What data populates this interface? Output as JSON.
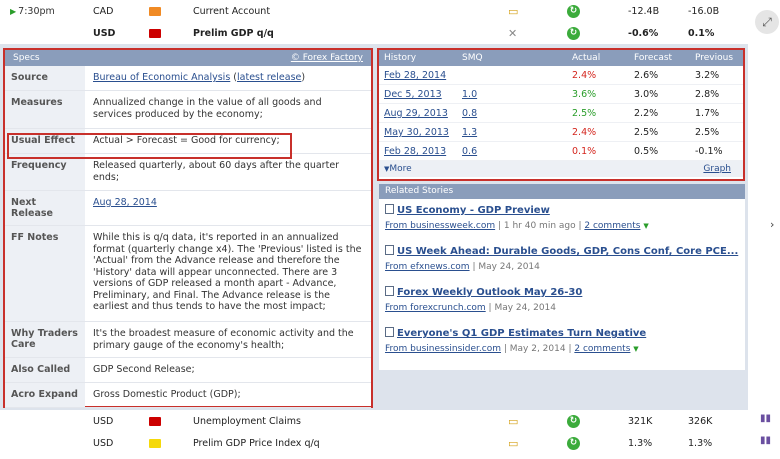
{
  "calendar": {
    "top_row": {
      "time": "7:30pm",
      "currency": "CAD",
      "flag_color": "#f08a24",
      "event": "Current Account",
      "actual": "-12.4B",
      "forecast": "-16.0B"
    },
    "usd_row": {
      "currency": "USD",
      "flag_color": "#cc0000",
      "event": "Prelim GDP q/q",
      "actual": "-0.6%",
      "forecast": "0.1%"
    },
    "bottom_rows": [
      {
        "currency": "USD",
        "flag_color": "#cc0000",
        "event": "Unemployment Claims",
        "actual": "321K",
        "forecast": "326K"
      },
      {
        "currency": "USD",
        "flag_color": "#f5d90a",
        "event": "Prelim GDP Price Index q/q",
        "actual": "1.3%",
        "forecast": "1.3%"
      }
    ]
  },
  "specs": {
    "header": "Specs",
    "source_link": "© Forex Factory",
    "rows": {
      "source": {
        "label": "Source",
        "link": "Bureau of Economic Analysis",
        "paren_open": " (",
        "link2": "latest release",
        "paren_close": ")"
      },
      "measures": {
        "label": "Measures",
        "value": "Annualized change in the value of all goods and services produced by the economy;"
      },
      "usual_effect": {
        "label": "Usual Effect",
        "value": "Actual > Forecast = Good for currency;"
      },
      "frequency": {
        "label": "Frequency",
        "value": "Released quarterly, about 60 days after the quarter ends;"
      },
      "next_release": {
        "label": "Next Release",
        "value": "Aug 28, 2014"
      },
      "ff_notes": {
        "label": "FF Notes",
        "value": "While this is q/q data, it's reported in an annualized format (quarterly change x4). The 'Previous' listed is the 'Actual' from the Advance release and therefore the 'History' data will appear unconnected. There are 3 versions of GDP released a month apart - Advance, Preliminary, and Final. The Advance release is the earliest and thus tends to have the most impact;"
      },
      "why_traders_care": {
        "label": "Why Traders Care",
        "value": "It's the broadest measure of economic activity and the primary gauge of the economy's health;"
      },
      "also_called": {
        "label": "Also Called",
        "value": "GDP Second Release;"
      },
      "acro_expand": {
        "label": "Acro Expand",
        "value": "Gross Domestic Product (GDP);"
      }
    }
  },
  "history": {
    "headers": {
      "history": "History",
      "smq": "SMQ",
      "actual": "Actual",
      "forecast": "Forecast",
      "previous": "Previous"
    },
    "rows": [
      {
        "date": "Feb 28, 2014",
        "smq": "",
        "actual": "2.4%",
        "actual_status": "red",
        "forecast": "2.6%",
        "previous": "3.2%"
      },
      {
        "date": "Dec 5, 2013",
        "smq": "1.0",
        "actual": "3.6%",
        "actual_status": "green",
        "forecast": "3.0%",
        "previous": "2.8%"
      },
      {
        "date": "Aug 29, 2013",
        "smq": "0.8",
        "actual": "2.5%",
        "actual_status": "green",
        "forecast": "2.2%",
        "previous": "1.7%"
      },
      {
        "date": "May 30, 2013",
        "smq": "1.3",
        "actual": "2.4%",
        "actual_status": "red",
        "forecast": "2.5%",
        "previous": "2.5%"
      },
      {
        "date": "Feb 28, 2013",
        "smq": "0.6",
        "actual": "0.1%",
        "actual_status": "red",
        "forecast": "0.5%",
        "previous": "-0.1%"
      }
    ],
    "more": "More",
    "graph": "Graph"
  },
  "related": {
    "header": "Related Stories",
    "stories": [
      {
        "title": "US Economy - GDP Preview",
        "source": "From businessweek.com",
        "sep1": " | ",
        "time": "1 hr 40 min ago",
        "sep2": " | ",
        "comments": "2 comments"
      },
      {
        "title": "US Week Ahead: Durable Goods, GDP, Cons Conf, Core PCE...",
        "source": "From efxnews.com",
        "sep1": " | ",
        "time": "May 24, 2014",
        "sep2": "",
        "comments": ""
      },
      {
        "title": "Forex Weekly Outlook May 26-30",
        "source": "From forexcrunch.com",
        "sep1": " | ",
        "time": "May 24, 2014",
        "sep2": "",
        "comments": ""
      },
      {
        "title": "Everyone's Q1 GDP Estimates Turn Negative",
        "source": "From businessinsider.com",
        "sep1": " | ",
        "time": "May 2, 2014",
        "sep2": " | ",
        "comments": "2 comments"
      }
    ]
  },
  "icons": {
    "expand": "expand-icon",
    "chevron": "chevron-right-icon",
    "more": "triangle-down-icon"
  }
}
